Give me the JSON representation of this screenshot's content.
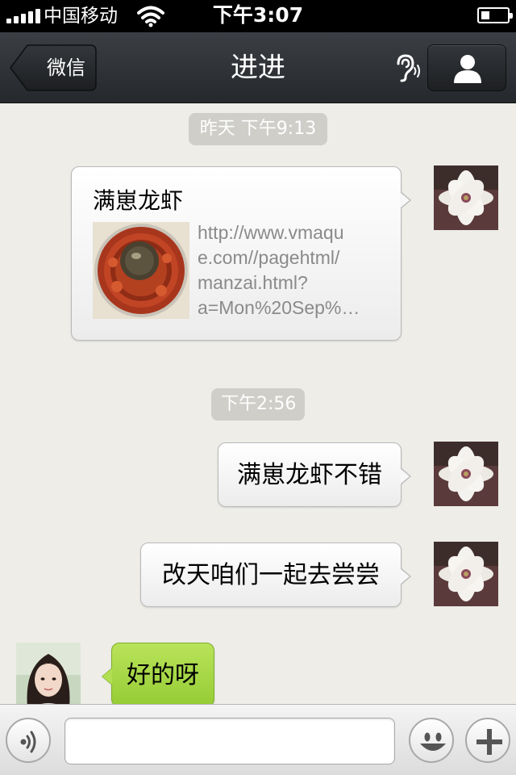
{
  "status_bar": {
    "carrier": "中国移动",
    "time": "下午3:07"
  },
  "nav": {
    "back_label": "微信",
    "title": "进进"
  },
  "messages": [
    {
      "type": "timestamp",
      "text": "昨天 下午9:13"
    },
    {
      "type": "link",
      "direction": "out",
      "title": "满崽龙虾",
      "url_lines": [
        "http://www.vmaqu",
        "e.com//pagehtml/",
        "manzai.html?",
        "a=Mon%20Sep%…"
      ]
    },
    {
      "type": "timestamp",
      "text": "下午2:56"
    },
    {
      "type": "text",
      "direction": "out",
      "text": "满崽龙虾不错"
    },
    {
      "type": "text",
      "direction": "out",
      "text": "改天咱们一起去尝尝"
    },
    {
      "type": "text",
      "direction": "in",
      "text": "好的呀"
    }
  ],
  "input_bar": {
    "placeholder": ""
  },
  "colors": {
    "nav_bg": "#2b2e32",
    "chat_bg": "#eeede8",
    "incoming_bubble": "#a6d645",
    "outgoing_bubble": "#f4f4f4",
    "timestamp_bg": "#cfcec9"
  },
  "icons": [
    "signal-icon",
    "wifi-icon",
    "battery-icon",
    "back-arrow-icon",
    "ear-icon",
    "contact-profile-icon",
    "voice-icon",
    "emoji-icon",
    "plus-icon"
  ]
}
